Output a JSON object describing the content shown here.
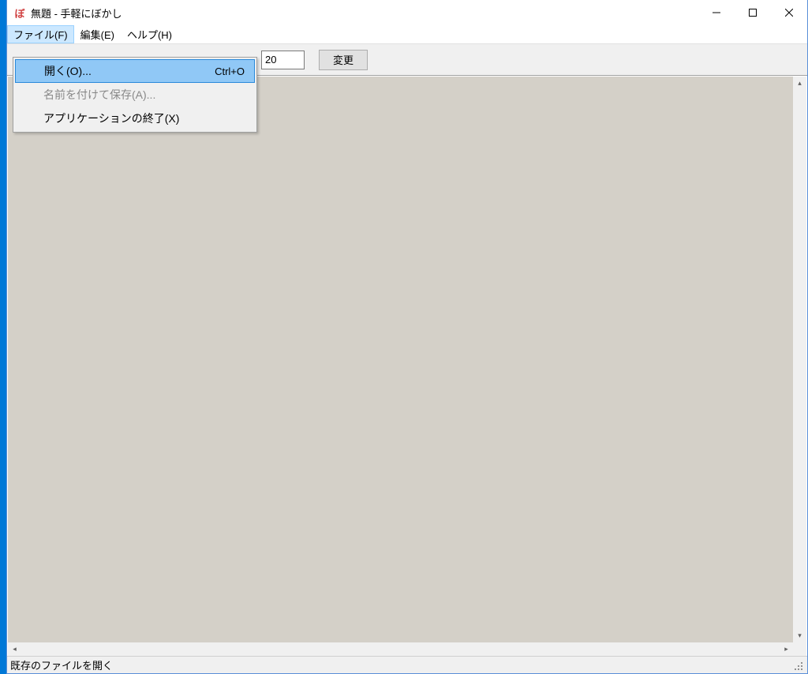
{
  "window": {
    "icon_text": "ぼ",
    "title": "無題 - 手軽にぼかし"
  },
  "menubar": {
    "file": "ファイル(F)",
    "edit": "編集(E)",
    "help": "ヘルプ(H)"
  },
  "toolbar": {
    "value": "20",
    "change_label": "変更"
  },
  "dropdown": {
    "open": {
      "label": "開く(O)...",
      "shortcut": "Ctrl+O"
    },
    "save_as": {
      "label": "名前を付けて保存(A)..."
    },
    "exit": {
      "label": "アプリケーションの終了(X)"
    }
  },
  "statusbar": {
    "text": "既存のファイルを開く"
  }
}
